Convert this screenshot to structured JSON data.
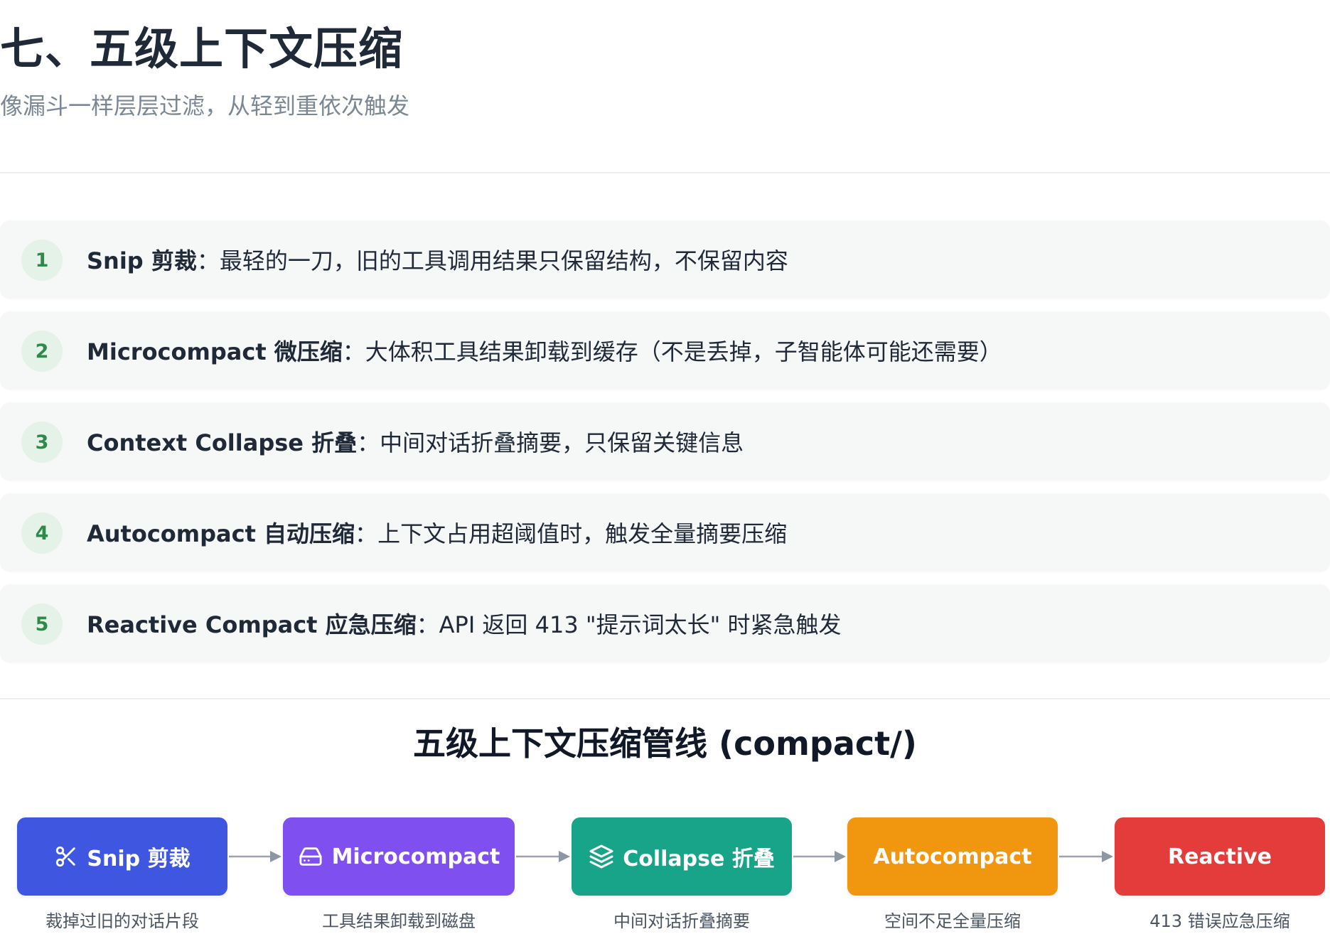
{
  "header": {
    "title": "七、五级上下文压缩",
    "subtitle": "像漏斗一样层层过滤，从轻到重依次触发"
  },
  "steps": [
    {
      "num": "1",
      "name": "Snip 剪裁",
      "sep": "：",
      "desc": "最轻的一刀，旧的工具调用结果只保留结构，不保留内容"
    },
    {
      "num": "2",
      "name": "Microcompact 微压缩",
      "sep": "：",
      "desc": "大体积工具结果卸载到缓存（不是丢掉，子智能体可能还需要）"
    },
    {
      "num": "3",
      "name": "Context Collapse 折叠",
      "sep": "：",
      "desc": "中间对话折叠摘要，只保留关键信息"
    },
    {
      "num": "4",
      "name": "Autocompact 自动压缩",
      "sep": "：",
      "desc": "上下文占用超阈值时，触发全量摘要压缩"
    },
    {
      "num": "5",
      "name": "Reactive Compact 应急压缩",
      "sep": "：",
      "desc": "API 返回 413 \"提示词太长\" 时紧急触发"
    }
  ],
  "pipeline": {
    "title": "五级上下文压缩管线 (compact/)",
    "stages": [
      {
        "label": "Snip 剪裁",
        "caption": "裁掉过旧的对话片段",
        "color": "#3f57e0",
        "icon": "scissors-icon"
      },
      {
        "label": "Microcompact",
        "caption": "工具结果卸载到磁盘",
        "color": "#7f50ef",
        "icon": "hard-drive-icon"
      },
      {
        "label": "Collapse 折叠",
        "caption": "中间对话折叠摘要",
        "color": "#17a489",
        "icon": "layers-icon"
      },
      {
        "label": "Autocompact",
        "caption": "空间不足全量压缩",
        "color": "#f0960f",
        "icon": ""
      },
      {
        "label": "Reactive",
        "caption": "413 错误应急压缩",
        "color": "#e43b3b",
        "icon": ""
      }
    ]
  }
}
